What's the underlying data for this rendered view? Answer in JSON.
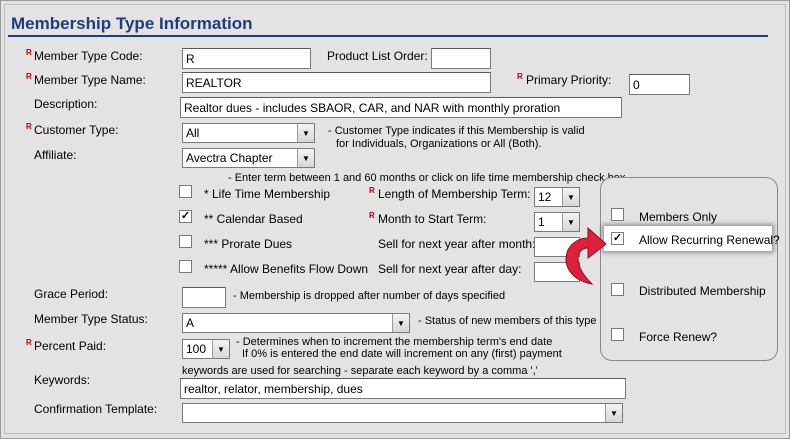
{
  "title": "Membership Type Information",
  "fields": {
    "member_type_code": {
      "label": "Member Type Code:",
      "value": "R"
    },
    "product_list_order": {
      "label": "Product List Order:",
      "value": ""
    },
    "member_type_name": {
      "label": "Member Type Name:",
      "value": "REALTOR"
    },
    "primary_priority": {
      "label": "Primary Priority:",
      "value": "0"
    },
    "description": {
      "label": "Description:",
      "value": "Realtor dues - includes SBAOR, CAR, and NAR with monthly proration"
    },
    "customer_type": {
      "label": "Customer Type:",
      "value": "All",
      "note_line1": "- Customer Type indicates if this Membership is valid",
      "note_line2": "for Individuals, Organizations or All (Both)."
    },
    "affiliate": {
      "label": "Affiliate:",
      "value": "Avectra Chapter"
    },
    "term_note": "- Enter term between 1 and 60 months or click on life time membership check box.",
    "life_time": {
      "label": "* Life Time Membership",
      "checked": false
    },
    "calendar_based": {
      "label": "** Calendar Based",
      "checked": true
    },
    "prorate_dues": {
      "label": "*** Prorate Dues",
      "checked": false
    },
    "benefits_flow_down": {
      "label": "***** Allow Benefits Flow Down",
      "checked": false
    },
    "length_of_term": {
      "label": "Length of Membership Term:",
      "value": "12"
    },
    "month_to_start": {
      "label": "Month to Start Term:",
      "value": "1"
    },
    "sell_after_month": {
      "label": "Sell for next year after month:",
      "value": ""
    },
    "sell_after_day": {
      "label": "Sell for next year after day:",
      "value": ""
    },
    "grace_period": {
      "label": "Grace Period:",
      "value": "",
      "note": "- Membership is dropped after number of days specified"
    },
    "member_type_status": {
      "label": "Member Type Status:",
      "value": "A",
      "note": "- Status of new members of this type"
    },
    "percent_paid": {
      "label": "Percent Paid:",
      "value": "100",
      "note_line1": "- Determines when to increment the membership term's end date",
      "note_line2": "If 0% is entered the end date will increment on any (first) payment"
    },
    "keywords": {
      "label": "Keywords:",
      "note": "keywords are used for searching - separate each keyword by a comma ','",
      "value": "realtor, relator, membership, dues"
    },
    "confirmation_template": {
      "label": "Confirmation Template:",
      "value": ""
    }
  },
  "side_options": {
    "members_only": {
      "label": "Members Only",
      "checked": false
    },
    "allow_recurring_renewal": {
      "label": "Allow Recurring Renewal?",
      "checked": true
    },
    "distributed_membership": {
      "label": "Distributed Membership",
      "checked": false
    },
    "force_renew": {
      "label": "Force Renew?",
      "checked": false
    }
  },
  "required_marker": "R",
  "colors": {
    "title": "#1f3d7a",
    "required": "#c00000",
    "arrow": "#e0203a",
    "background": "#e3e3e3"
  }
}
